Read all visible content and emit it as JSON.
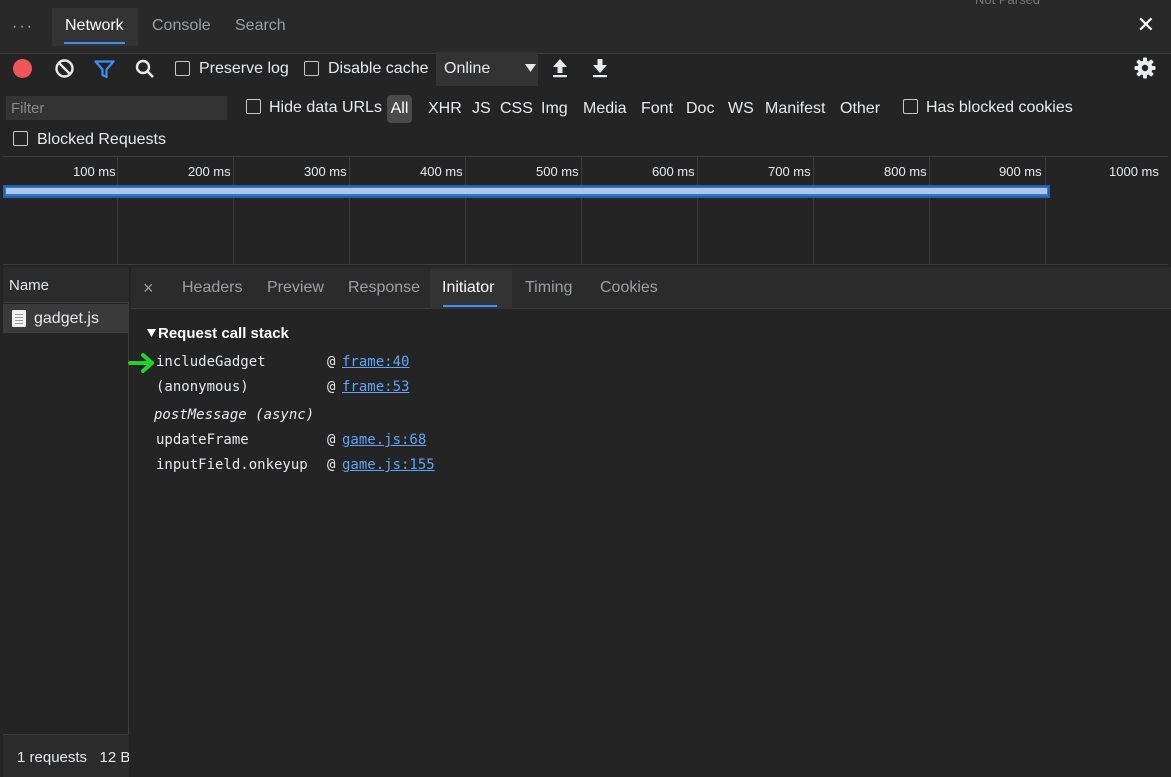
{
  "tabbar": {
    "more": "···",
    "tabs": [
      "Network",
      "Console",
      "Search"
    ],
    "active_tab": "Network",
    "close": "✕"
  },
  "toolbar": {
    "preserve_log": "Preserve log",
    "disable_cache": "Disable cache",
    "throttling": "Online"
  },
  "filter": {
    "placeholder": "Filter",
    "hide_data_urls": "Hide data URLs",
    "types": [
      "All",
      "XHR",
      "JS",
      "CSS",
      "Img",
      "Media",
      "Font",
      "Doc",
      "WS",
      "Manifest",
      "Other"
    ],
    "has_blocked_cookies": "Has blocked cookies",
    "blocked_requests": "Blocked Requests"
  },
  "overview": {
    "ticks": [
      "100 ms",
      "200 ms",
      "300 ms",
      "400 ms",
      "500 ms",
      "600 ms",
      "700 ms",
      "800 ms",
      "900 ms",
      "1000 ms"
    ]
  },
  "requests": {
    "header": "Name",
    "items": [
      "gadget.js"
    ],
    "status": "1 requests   12 B"
  },
  "details": {
    "close": "×",
    "tabs": [
      "Headers",
      "Preview",
      "Response",
      "Initiator",
      "Timing",
      "Cookies"
    ],
    "active_tab": "Initiator",
    "section_title": "Request call stack",
    "frames": [
      {
        "fn": "includeGadget",
        "at": "@",
        "loc": "frame:40"
      },
      {
        "fn": "(anonymous)",
        "at": "@",
        "loc": "frame:53"
      },
      {
        "async": "postMessage (async)"
      },
      {
        "fn": "updateFrame",
        "at": "@",
        "loc": "game.js:68"
      },
      {
        "fn": "inputField.onkeyup",
        "at": "@",
        "loc": "game.js:155"
      }
    ]
  },
  "colors": {
    "accent": "#3e8ef7",
    "record": "#f0555a",
    "link": "#5fa5f5",
    "arrow": "#23d12a"
  }
}
